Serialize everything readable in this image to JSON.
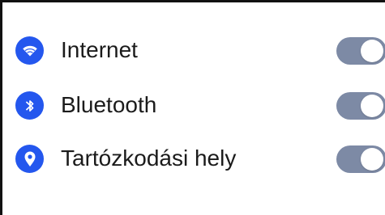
{
  "settings": {
    "items": [
      {
        "label": "Internet",
        "icon": "wifi-icon",
        "enabled": true
      },
      {
        "label": "Bluetooth",
        "icon": "bluetooth-icon",
        "enabled": true
      },
      {
        "label": "Tartózkodási hely",
        "icon": "location-pin-icon",
        "enabled": true
      }
    ]
  },
  "colors": {
    "icon_background": "#2457ee",
    "icon_glyph": "#ffffff",
    "toggle_track": "#7d8aa5",
    "toggle_knob": "#ffffff",
    "text": "#1b1b1b"
  }
}
